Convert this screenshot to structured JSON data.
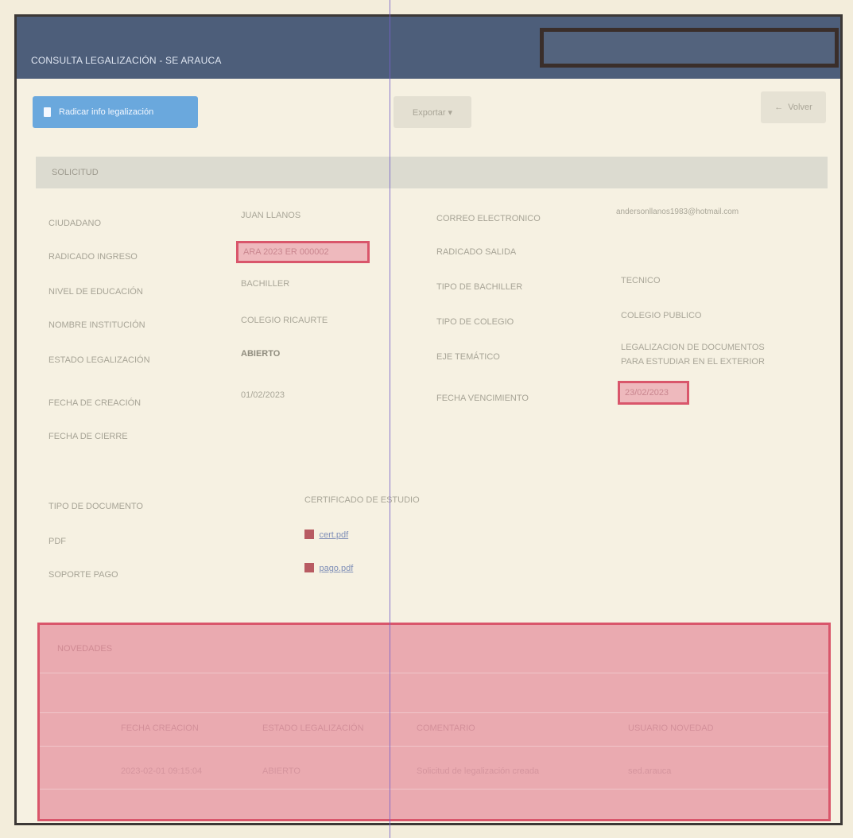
{
  "header": {
    "title": "CONSULTA LEGALIZACIÓN - SE ARAUCA"
  },
  "toolbar": {
    "radicar_label": "Radicar info legalización",
    "exportar_label": "Exportar ▾",
    "volver_label": "Volver"
  },
  "solicitud": {
    "section_label": "SOLICITUD",
    "rows": [
      {
        "label": "CIUDADANO",
        "value": "JUAN LLANOS"
      },
      {
        "label": "RADICADO INGRESO",
        "value": "ARA 2023 ER 000002"
      },
      {
        "label": "NIVEL DE EDUCACIÓN",
        "value": "BACHILLER"
      },
      {
        "label": "NOMBRE INSTITUCIÓN",
        "value": "COLEGIO RICAURTE"
      },
      {
        "label": "ESTADO LEGALIZACIÓN",
        "value": "ABIERTO"
      },
      {
        "label": "FECHA DE CREACIÓN",
        "value": "01/02/2023"
      },
      {
        "label": "FECHA DE CIERRE",
        "value": ""
      }
    ],
    "right_rows": [
      {
        "label": "CORREO ELECTRONICO",
        "value": "andersonllanos1983@hotmail.com"
      },
      {
        "label": "RADICADO SALIDA",
        "value": ""
      },
      {
        "label": "TIPO DE BACHILLER",
        "value": "TECNICO"
      },
      {
        "label": "TIPO DE COLEGIO",
        "value": "COLEGIO PUBLICO"
      },
      {
        "label": "EJE TEMÁTICO",
        "value_line1": "LEGALIZACION DE DOCUMENTOS",
        "value_line2": "PARA ESTUDIAR EN EL EXTERIOR"
      },
      {
        "label": "FECHA VENCIMIENTO",
        "value": "23/02/2023"
      }
    ]
  },
  "documento": {
    "tipo_label": "TIPO DE DOCUMENTO",
    "tipo_value": "CERTIFICADO DE ESTUDIO",
    "pdf_label": "PDF",
    "pdf_file": "cert.pdf",
    "soporte_label": "SOPORTE PAGO",
    "soporte_file": "pago.pdf"
  },
  "novedades": {
    "title": "NOVEDADES",
    "headers": [
      "FECHA CREACION",
      "ESTADO LEGALIZACIÓN",
      "COMENTARIO",
      "USUARIO NOVEDAD"
    ],
    "row": [
      "2023-02-01 09:15:04",
      "ABIERTO",
      "Solicitud de legalización creada",
      "sed.arauca"
    ]
  }
}
